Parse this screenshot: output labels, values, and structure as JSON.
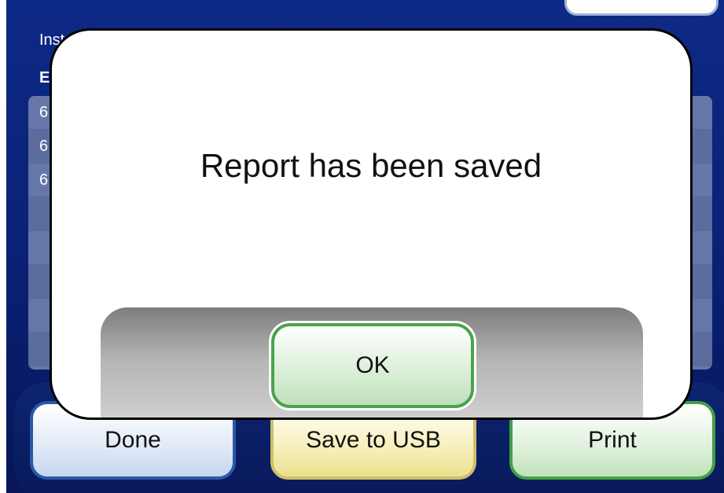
{
  "background": {
    "instructions_label": "Inst",
    "bold_label": "E",
    "rows": [
      {
        "text": "6"
      },
      {
        "text": "6"
      },
      {
        "text": "6"
      },
      {
        "text": ""
      },
      {
        "text": ""
      },
      {
        "text": ""
      },
      {
        "text": ""
      },
      {
        "text": ""
      }
    ]
  },
  "actions": {
    "done_label": "Done",
    "save_usb_label": "Save to USB",
    "print_label": "Print"
  },
  "dialog": {
    "message": "Report has been saved",
    "ok_label": "OK"
  },
  "colors": {
    "screen_background": "#0d2a86",
    "done_border": "#2a57a8",
    "save_usb_border": "#d0bf6a",
    "print_border": "#43a045",
    "ok_border": "#4aa34d"
  }
}
